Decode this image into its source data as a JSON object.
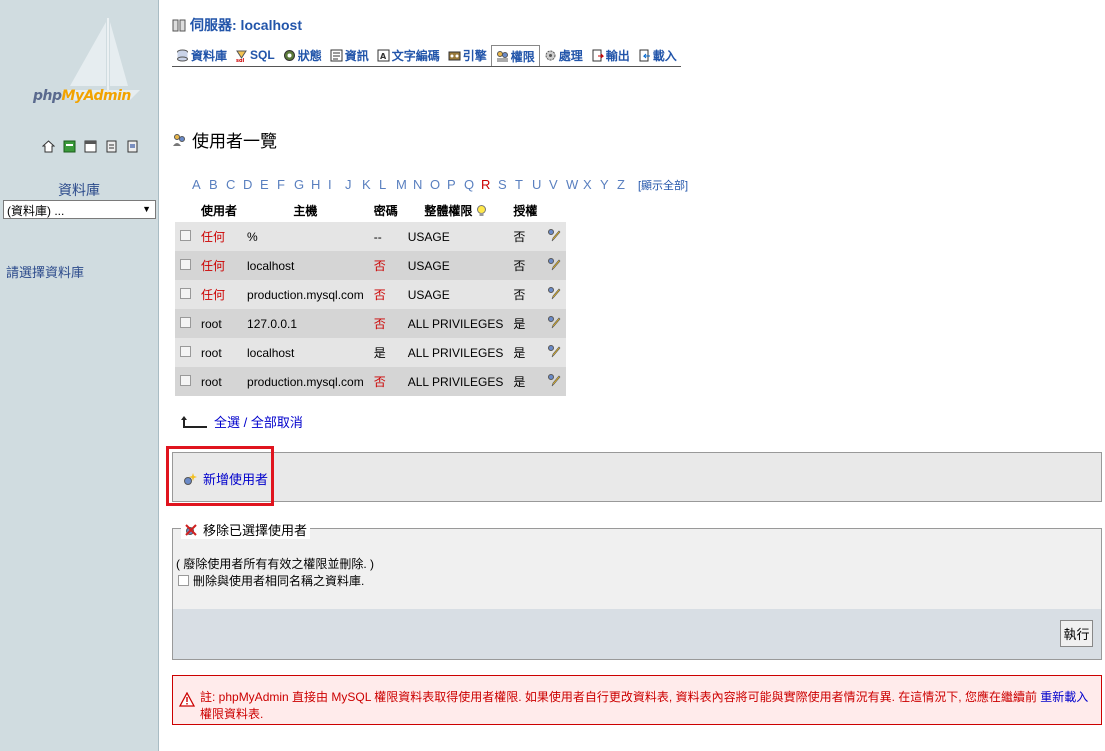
{
  "sidebar": {
    "logo_prefix": "php",
    "logo_brand": "MyAdmin",
    "icons": [
      "home-icon",
      "exit-icon",
      "sql-window-icon",
      "docs-icon",
      "query-icon"
    ],
    "db_label": "資料庫",
    "db_select_value": "(資料庫) ...",
    "hint": "請選擇資料庫"
  },
  "header": {
    "server_label": "伺服器: localhost"
  },
  "tabs": [
    {
      "label": "資料庫",
      "icon": "database-icon",
      "active": false
    },
    {
      "label": "SQL",
      "icon": "sql-icon",
      "active": false
    },
    {
      "label": "狀態",
      "icon": "status-icon",
      "active": false
    },
    {
      "label": "資訊",
      "icon": "info-icon",
      "active": false
    },
    {
      "label": "文字編碼",
      "icon": "charset-icon",
      "active": false
    },
    {
      "label": "引擎",
      "icon": "engine-icon",
      "active": false
    },
    {
      "label": "權限",
      "icon": "privileges-icon",
      "active": true
    },
    {
      "label": "處理",
      "icon": "process-icon",
      "active": false
    },
    {
      "label": "輸出",
      "icon": "export-icon",
      "active": false
    },
    {
      "label": "載入",
      "icon": "import-icon",
      "active": false
    }
  ],
  "page_title": "使用者一覽",
  "letters": [
    "A",
    "B",
    "C",
    "D",
    "E",
    "F",
    "G",
    "H",
    "I",
    "J",
    "K",
    "L",
    "M",
    "N",
    "O",
    "P",
    "Q",
    "R",
    "S",
    "T",
    "U",
    "V",
    "W",
    "X",
    "Y",
    "Z"
  ],
  "letter_active": "R",
  "show_all": "[顯示全部]",
  "table": {
    "headers": [
      "使用者",
      "主機",
      "密碼",
      "整體權限",
      "授權"
    ],
    "rows": [
      {
        "user": "任何",
        "host": "%",
        "password": "--",
        "privileges": "USAGE",
        "grant": "否"
      },
      {
        "user": "任何",
        "host": "localhost",
        "password": "否",
        "privileges": "USAGE",
        "grant": "否"
      },
      {
        "user": "任何",
        "host": "production.mysql.com",
        "password": "否",
        "privileges": "USAGE",
        "grant": "否"
      },
      {
        "user": "root",
        "host": "127.0.0.1",
        "password": "否",
        "privileges": "ALL PRIVILEGES",
        "grant": "是"
      },
      {
        "user": "root",
        "host": "localhost",
        "password": "是",
        "privileges": "ALL PRIVILEGES",
        "grant": "是"
      },
      {
        "user": "root",
        "host": "production.mysql.com",
        "password": "否",
        "privileges": "ALL PRIVILEGES",
        "grant": "是"
      }
    ]
  },
  "check_all": "全選 / 全部取消",
  "add_user": "新增使用者",
  "remove": {
    "legend": "移除已選擇使用者",
    "note": "( 廢除使用者所有有效之權限並刪除. )",
    "drop_db": "刪除與使用者相同名稱之資料庫."
  },
  "go_button": "執行",
  "notice": {
    "before": "註: phpMyAdmin 直接由 MySQL 權限資料表取得使用者權限. 如果使用者自行更改資料表, 資料表內容將可能與實際使用者情況有異. 在這情況下, 您應在繼續前 ",
    "link": "重新載入",
    "after": " 權限資料表."
  },
  "colors": {
    "sidebar_bg": "#d0dce0",
    "link": "#2255aa",
    "warning": "#cc0000",
    "highlight": "#e0141e"
  }
}
